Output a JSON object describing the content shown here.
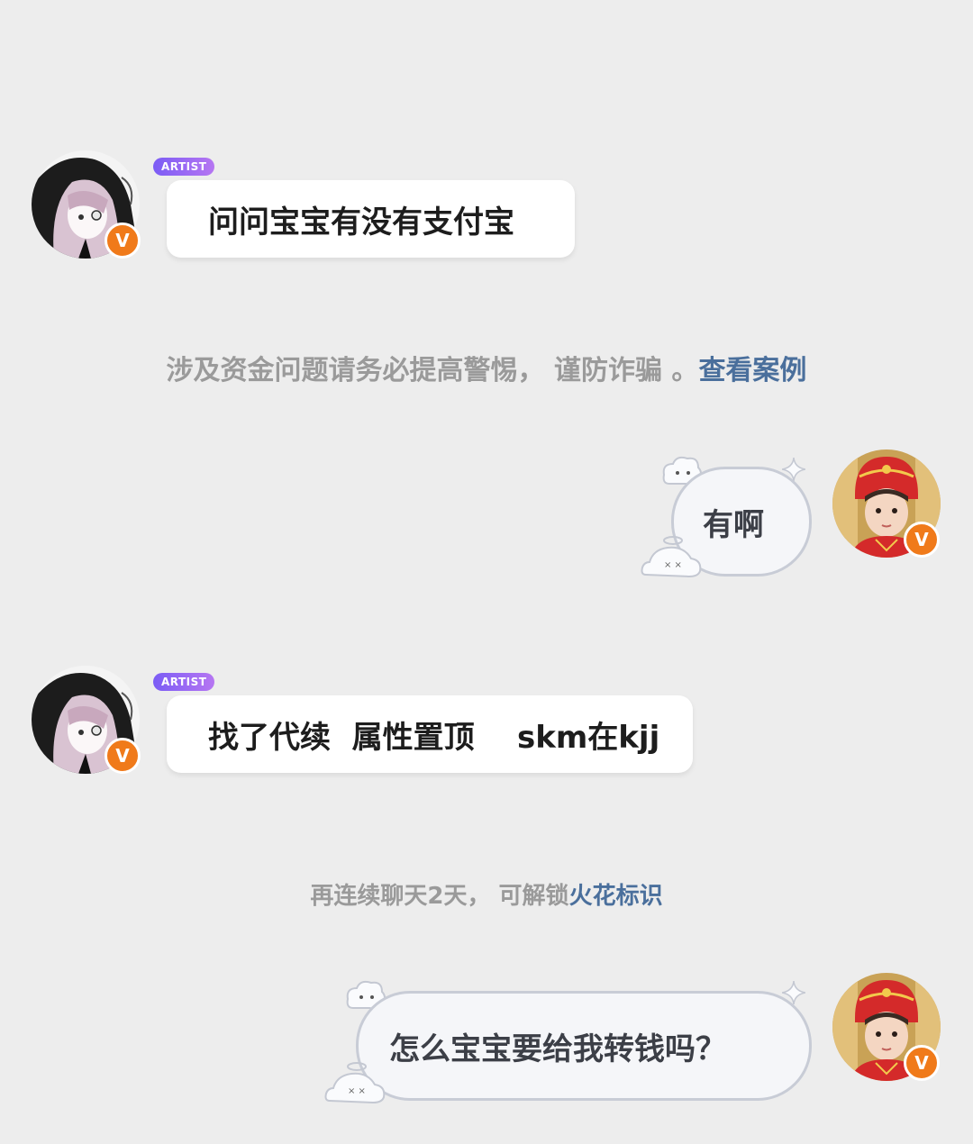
{
  "messages": [
    {
      "sender": "other",
      "badge": "ARTIST",
      "text": "问问宝宝有没有支付宝"
    },
    {
      "sender": "self",
      "text": "有啊"
    },
    {
      "sender": "other",
      "badge": "ARTIST",
      "text": "找了代续  属性置顶    skm在kjj"
    },
    {
      "sender": "self",
      "text": "怎么宝宝要给我转钱吗？"
    }
  ],
  "notices": {
    "fraud": {
      "text": "涉及资金问题请务必提高警惕， 谨防诈骗 。",
      "link": "查看案例"
    },
    "streak": {
      "text": "再连续聊天2天， 可解锁",
      "link": "火花标识"
    }
  },
  "verified_badge": "V",
  "colors": {
    "background": "#ededed",
    "badge_orange": "#f07a1a",
    "link_blue": "#4a6f9c",
    "artist_purple": "#7b5cf5"
  }
}
